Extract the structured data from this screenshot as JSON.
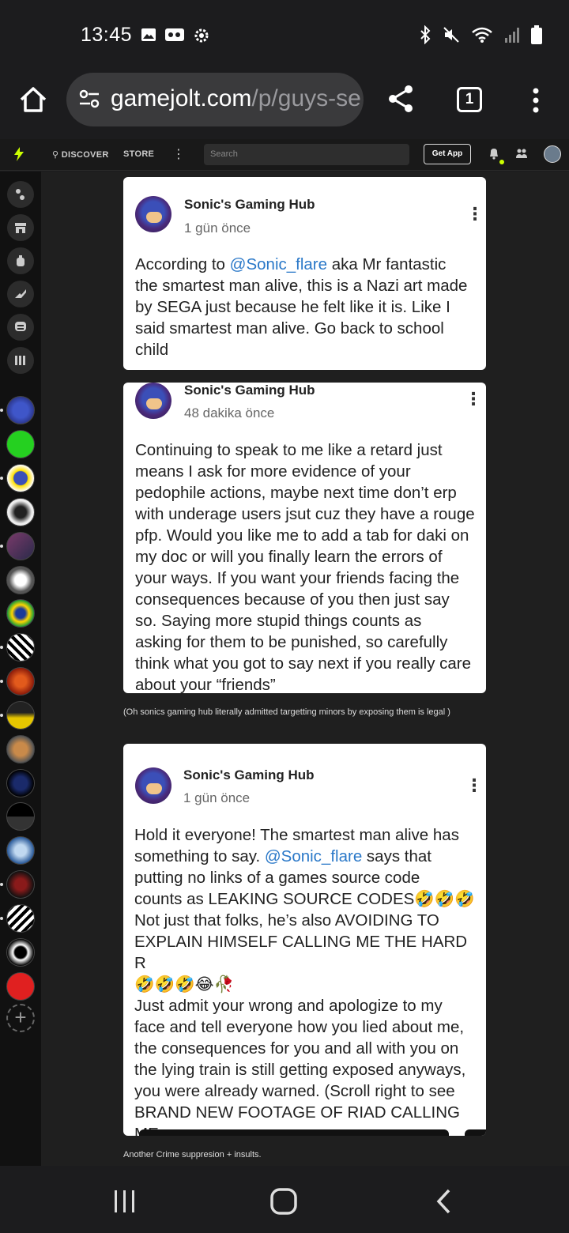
{
  "status_bar": {
    "time": "13:45",
    "left_icons": [
      "gallery-icon",
      "voicemail-icon",
      "settings-gear-icon"
    ],
    "right_icons": [
      "bluetooth-icon",
      "mute-icon",
      "wifi-icon",
      "signal-icon",
      "battery-icon"
    ]
  },
  "browser": {
    "url_host": "gamejolt.com",
    "url_path": "/p/guys-se",
    "tab_count": "1"
  },
  "gj_nav": {
    "discover": "DISCOVER",
    "store": "STORE",
    "search_placeholder": "Search",
    "get_app": "Get App"
  },
  "posts": [
    {
      "author": "Sonic's Gaming Hub",
      "time": "1 gün önce",
      "body_pre": "According to ",
      "mention": "@Sonic_flare",
      "body_post": "  aka Mr fantastic\nthe smartest man alive, this is a Nazi art made\nby SEGA just because he felt like it is. Like I\nsaid smartest man alive. Go back to school\nchild"
    },
    {
      "author": "Sonic's Gaming Hub",
      "time": "48 dakika önce",
      "body": "Continuing to speak to me like a retard just\nmeans I ask for more evidence of your\npedophile actions, maybe next time don’t erp\nwith underage users jsut cuz they have a rouge\npfp. Would you like me to add a tab for daki on\nmy doc or will you finally learn the errors of\nyour ways. If you want your friends facing the\nconsequences because of you then just say\nso. Saying more stupid things counts as\nasking for them to be punished, so carefully\nthink what you got to say next if you really care\nabout your “friends”"
    },
    {
      "author": "Sonic's Gaming Hub",
      "time": "1 gün önce",
      "body_pre": "Hold it everyone! The smartest man alive has\nsomething to say. ",
      "mention": "@Sonic_flare",
      "body_post": " says that\nputting no links of a games source code\ncounts as LEAKING SOURCE CODES🤣🤣🤣\nNot just that folks, he’s also AVOIDING TO\nEXPLAIN HIMSELF CALLING ME THE HARD R\n🤣🤣🤣😂🥀\nJust admit your wrong and apologize to my\nface and tell everyone how you lied about me,\nthe consequences for you and all with you on\nthe lying train is still getting exposed anyways,\nyou were already warned. (Scroll right to see\nBRAND NEW FOOTAGE OF RIAD CALLING ME\nTHE HARD R)"
    }
  ],
  "captions": {
    "after_post_2": "(Oh sonics gaming hub literally admitted targetting minors by exposing them is legal )",
    "after_post_3": "Another Crime suppresion + insults."
  },
  "colors": {
    "accent": "#ccff00",
    "mention": "#2a78c8"
  }
}
